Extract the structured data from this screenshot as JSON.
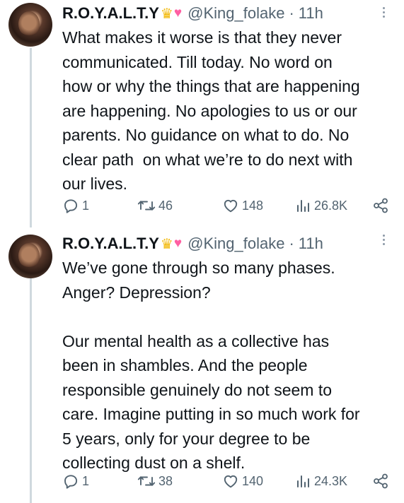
{
  "tweets": [
    {
      "author_name": "R.O.Y.A.L.T.Y",
      "author_emojis": [
        "crown-emoji",
        "heart-emoji"
      ],
      "handle": "@King_folake",
      "separator": "·",
      "time": "11h",
      "text": "What makes it worse is that they never\ncommunicated. Till today. No word on\nhow or why the things that are happening\nare happening. No apologies to us or our\nparents. No guidance on what to do. No\nclear path  on what we’re to do next with\nour lives.",
      "replies": "1",
      "retweets": "46",
      "likes": "148",
      "views": "26.8K"
    },
    {
      "author_name": "R.O.Y.A.L.T.Y",
      "author_emojis": [
        "crown-emoji",
        "heart-emoji"
      ],
      "handle": "@King_folake",
      "separator": "·",
      "time": "11h",
      "text": "We’ve gone through so many phases.\nAnger? Depression?\n\nOur mental health as a collective has\nbeen in shambles. And the people\nresponsible genuinely do not seem to\ncare. Imagine putting in so much work for\n5 years, only for your degree to be\ncollecting dust on a shelf.",
      "replies": "1",
      "retweets": "38",
      "likes": "140",
      "views": "24.3K"
    }
  ],
  "colors": {
    "text": "#0f1419",
    "muted": "#536471",
    "thread_line": "#cfd9de",
    "background": "#ffffff"
  }
}
